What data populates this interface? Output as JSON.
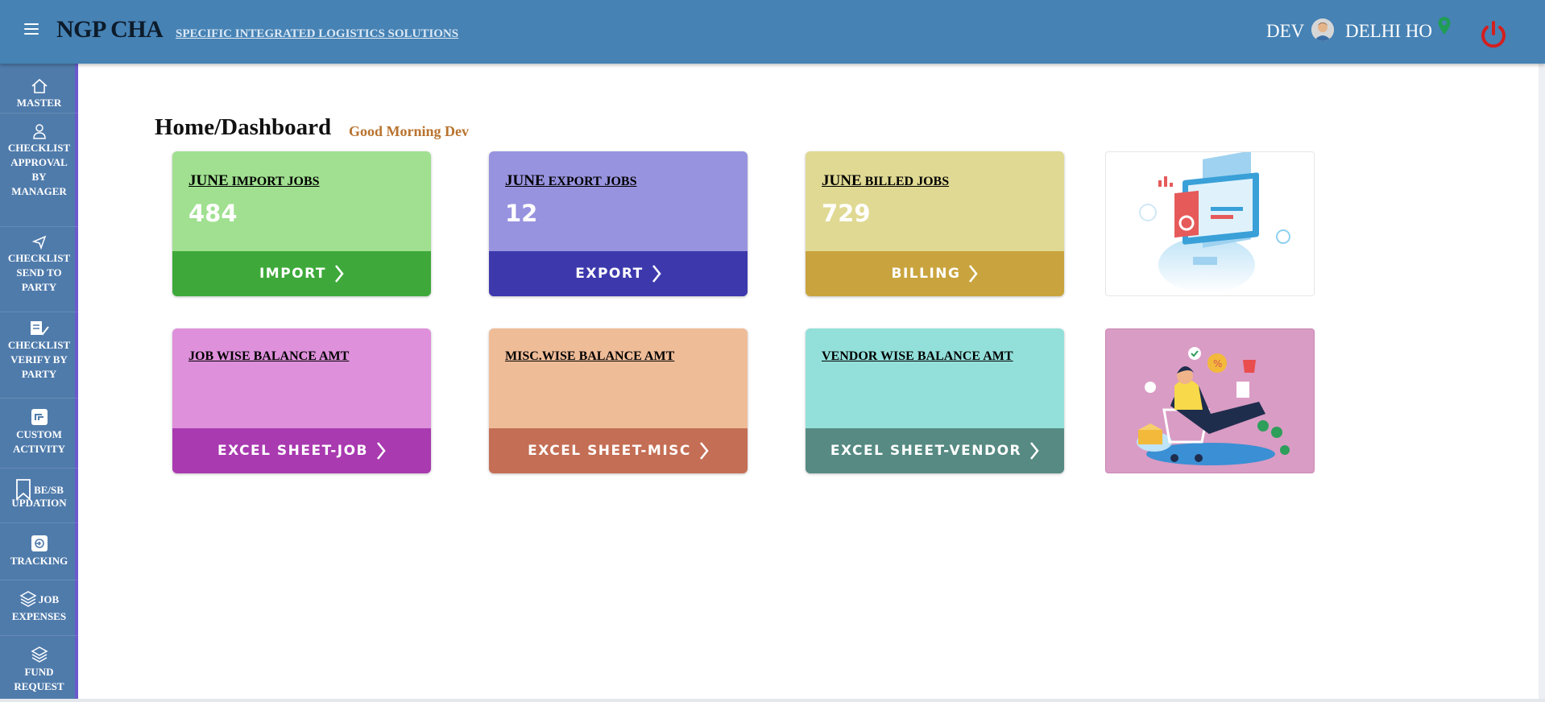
{
  "header": {
    "brand": "NGP CHA",
    "tagline": "SPECIFIC INTEGRATED LOGISTICS SOLUTIONS",
    "user": "DEV",
    "branch": "DELHI HO",
    "icons": [
      "menu-icon",
      "avatar",
      "location-pin-icon",
      "power-icon"
    ]
  },
  "sidebar": {
    "items": [
      {
        "label": "MASTER",
        "icon": "home-icon"
      },
      {
        "label": "CHECKLIST APPROVAL BY MANAGER",
        "lines": [
          "CHECKLIST",
          "APPROVAL",
          "BY",
          "MANAGER"
        ],
        "icon": "user-icon"
      },
      {
        "label": "CHECKLIST SEND TO PARTY",
        "lines": [
          "CHECKLIST",
          "SEND TO",
          "PARTY"
        ],
        "icon": "send-icon"
      },
      {
        "label": "CHECKLIST VERIFY BY PARTY",
        "lines": [
          "CHECKLIST",
          "VERIFY BY",
          "PARTY"
        ],
        "icon": "verify-icon"
      },
      {
        "label": "CUSTOM ACTIVITY",
        "lines": [
          "CUSTOM",
          "ACTIVITY"
        ],
        "icon": "custom-icon"
      },
      {
        "label": "BE/SB UPDATION",
        "lines": [
          "BE/SB",
          "UPDATION"
        ],
        "icon": "bookmark-icon"
      },
      {
        "label": "TRACKING",
        "icon": "tracking-icon"
      },
      {
        "label": "JOB EXPENSES",
        "lines": [
          "JOB",
          "EXPENSES"
        ],
        "icon": "layers-icon"
      },
      {
        "label": "FUND REQUEST",
        "lines": [
          "FUND",
          "REQUEST"
        ],
        "icon": "layers-icon"
      }
    ]
  },
  "main": {
    "title": "Home/Dashboard",
    "greeting": "Good Morning Dev",
    "cards": [
      {
        "month": "JUNE",
        "title": "IMPORT JOBS",
        "count": "484",
        "button": "IMPORT",
        "bg": "#a0e090",
        "btn_bg": "#3ea93a"
      },
      {
        "month": "JUNE",
        "title": "EXPORT JOBS",
        "count": "12",
        "button": "EXPORT",
        "bg": "#9893df",
        "btn_bg": "#3d39ad"
      },
      {
        "month": "JUNE",
        "title": "BILLED JOBS",
        "count": "729",
        "button": "BILLING",
        "bg": "#e0d993",
        "btn_bg": "#c9a43e"
      },
      {
        "title": "JOB WISE BALANCE AMT",
        "button": "EXCEL SHEET-JOB",
        "bg": "#de90db",
        "btn_bg": "#a93ab0"
      },
      {
        "title": "MISC.WISE BALANCE AMT",
        "button": "EXCEL SHEET-MISC",
        "bg": "#efbc98",
        "btn_bg": "#c46e55"
      },
      {
        "title": "VENDOR WISE BALANCE AMT",
        "button": "EXCEL SHEET-VENDOR",
        "bg": "#93e0da",
        "btn_bg": "#568a82"
      }
    ]
  }
}
